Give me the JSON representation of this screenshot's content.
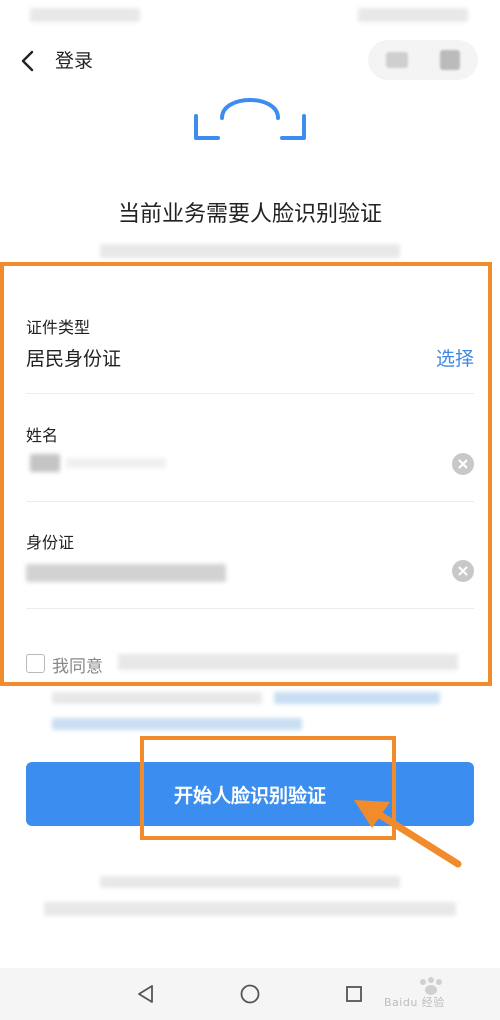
{
  "header": {
    "title": "登录"
  },
  "main": {
    "title": "当前业务需要人脸识别验证"
  },
  "form": {
    "id_type": {
      "label": "证件类型",
      "value": "居民身份证",
      "action": "选择"
    },
    "name": {
      "label": "姓名",
      "value": ""
    },
    "id_number": {
      "label": "身份证",
      "value": ""
    },
    "agreement": {
      "text": "我同意",
      "checked": false
    }
  },
  "primary_button": {
    "label": "开始人脸识别验证"
  },
  "watermark": {
    "text": "Baidu 经验"
  },
  "colors": {
    "accent": "#3b8ef0",
    "link": "#3d8be6",
    "highlight": "#f28b2c"
  }
}
